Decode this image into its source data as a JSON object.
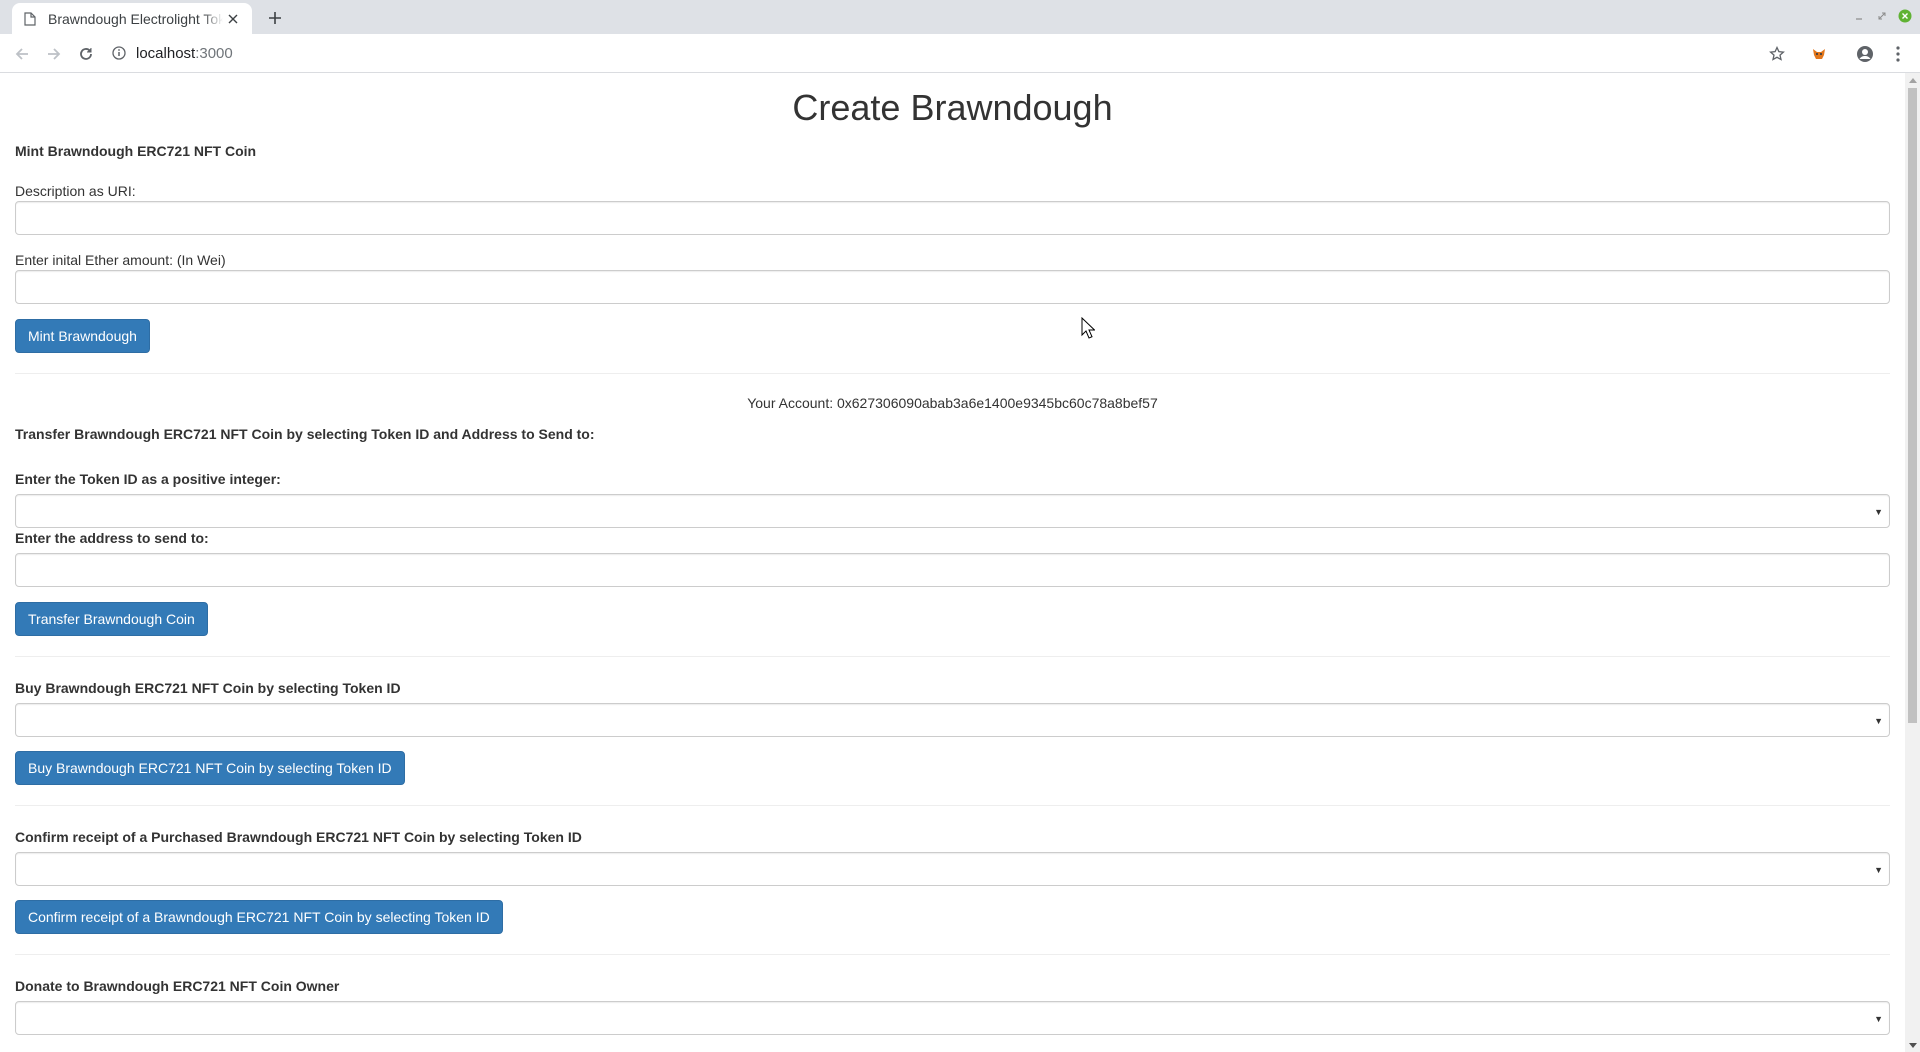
{
  "browser": {
    "tab_title": "Brawndough Electrolight Token",
    "url_host": "localhost",
    "url_port": ":3000"
  },
  "page": {
    "title": "Create Brawndough",
    "mint": {
      "heading": "Mint Brawndough ERC721 NFT Coin",
      "description_label": "Description as URI:",
      "description_value": "",
      "ether_label": "Enter inital Ether amount: (In Wei)",
      "ether_value": "",
      "button": "Mint Brawndough"
    },
    "account": "Your Account: 0x627306090abab3a6e1400e9345bc60c78a8bef57",
    "transfer": {
      "heading": "Transfer Brawndough ERC721 NFT Coin by selecting Token ID and Address to Send to:",
      "token_label": "Enter the Token ID as a positive integer:",
      "token_selected": "",
      "address_label": "Enter the address to send to:",
      "address_value": "",
      "button": "Transfer Brawndough Coin"
    },
    "buy": {
      "heading": "Buy Brawndough ERC721 NFT Coin by selecting Token ID",
      "token_selected": "",
      "button": "Buy Brawndough ERC721 NFT Coin by selecting Token ID"
    },
    "confirm": {
      "heading": "Confirm receipt of a Purchased Brawndough ERC721 NFT Coin by selecting Token ID",
      "token_selected": "",
      "button": "Confirm receipt of a Brawndough ERC721 NFT Coin by selecting Token ID"
    },
    "donate": {
      "heading": "Donate to Brawndough ERC721 NFT Coin Owner",
      "token_selected": ""
    }
  },
  "colors": {
    "primary_button": "#337ab7",
    "tabstrip": "#dee1e6"
  },
  "icons": [
    "page-icon",
    "close-icon",
    "plus-icon",
    "minimize-icon",
    "maximize-icon",
    "window-close-icon",
    "back-arrow-icon",
    "forward-arrow-icon",
    "reload-icon",
    "info-icon",
    "star-icon",
    "fox-extension-icon",
    "account-icon",
    "menu-dots-icon",
    "caret-down-icon",
    "mouse-cursor-icon"
  ]
}
